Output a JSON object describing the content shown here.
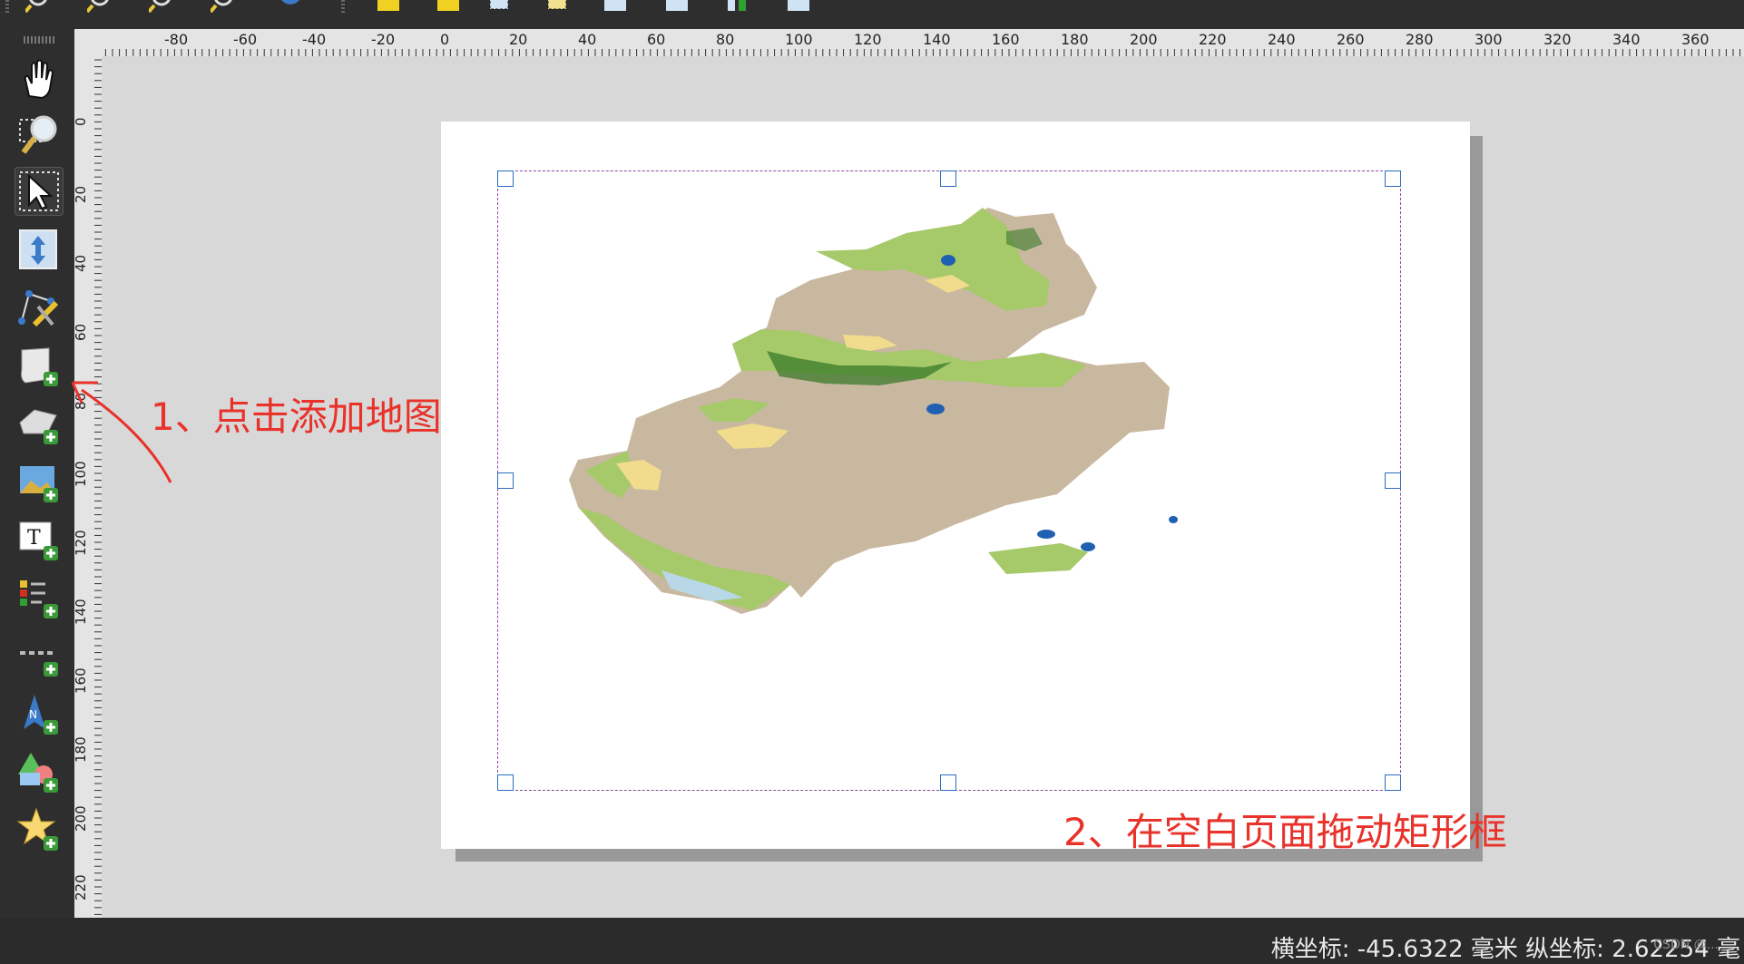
{
  "top_toolbar": {
    "icons": [
      "zoom-full-icon",
      "zoom-in-icon",
      "zoom-out-icon",
      "zoom-actual-icon",
      "refresh-icon",
      "raise-item-icon",
      "lower-item-icon",
      "move-content-icon",
      "edit-nodes-icon",
      "align-left-icon",
      "align-center-icon",
      "distribute-icon",
      "resize-icon"
    ]
  },
  "left_toolbar": {
    "tools": [
      {
        "name": "pan-tool",
        "icon": "hand-icon"
      },
      {
        "name": "zoom-tool",
        "icon": "magnifier-icon"
      },
      {
        "name": "select-move-tool",
        "icon": "arrow-select-icon",
        "active": true
      },
      {
        "name": "move-content-tool",
        "icon": "move-content-icon"
      },
      {
        "name": "edit-nodes-tool",
        "icon": "edit-nodes-icon"
      },
      {
        "name": "add-map-tool",
        "icon": "add-map-icon"
      },
      {
        "name": "add-3d-map-tool",
        "icon": "add-3d-map-icon"
      },
      {
        "name": "add-picture-tool",
        "icon": "add-picture-icon"
      },
      {
        "name": "add-label-tool",
        "icon": "add-label-icon"
      },
      {
        "name": "add-legend-tool",
        "icon": "add-legend-icon"
      },
      {
        "name": "add-scalebar-tool",
        "icon": "add-scalebar-icon"
      },
      {
        "name": "add-north-arrow-tool",
        "icon": "add-north-arrow-icon"
      },
      {
        "name": "add-shape-tool",
        "icon": "add-shape-icon"
      },
      {
        "name": "add-marker-tool",
        "icon": "add-marker-icon"
      }
    ]
  },
  "rulers": {
    "horizontal_labels": [
      "-80",
      "-60",
      "-40",
      "-20",
      "0",
      "20",
      "40",
      "60",
      "80",
      "100",
      "120",
      "140",
      "160",
      "180",
      "200",
      "220",
      "240",
      "260",
      "280",
      "300",
      "320",
      "340",
      "360"
    ],
    "vertical_labels": [
      "0",
      "20",
      "40",
      "60",
      "80",
      "100",
      "120",
      "140",
      "160",
      "180",
      "200",
      "220"
    ]
  },
  "annotations": {
    "step1": "1、点击添加地图",
    "step2": "2、在空白页面拖动矩形框"
  },
  "status": {
    "text": "横坐标: -45.6322 毫米 纵坐标: 2.62254 毫",
    "watermark": "CSDN @..."
  },
  "colors": {
    "annotation": "#e8322a",
    "selection_handle": "#2a6ebf",
    "map_desert": "#c9b8a0",
    "map_grass": "#a6c96a",
    "map_sand": "#f0dc8c",
    "map_forest": "#3a7a2a",
    "map_water": "#2060b0"
  }
}
